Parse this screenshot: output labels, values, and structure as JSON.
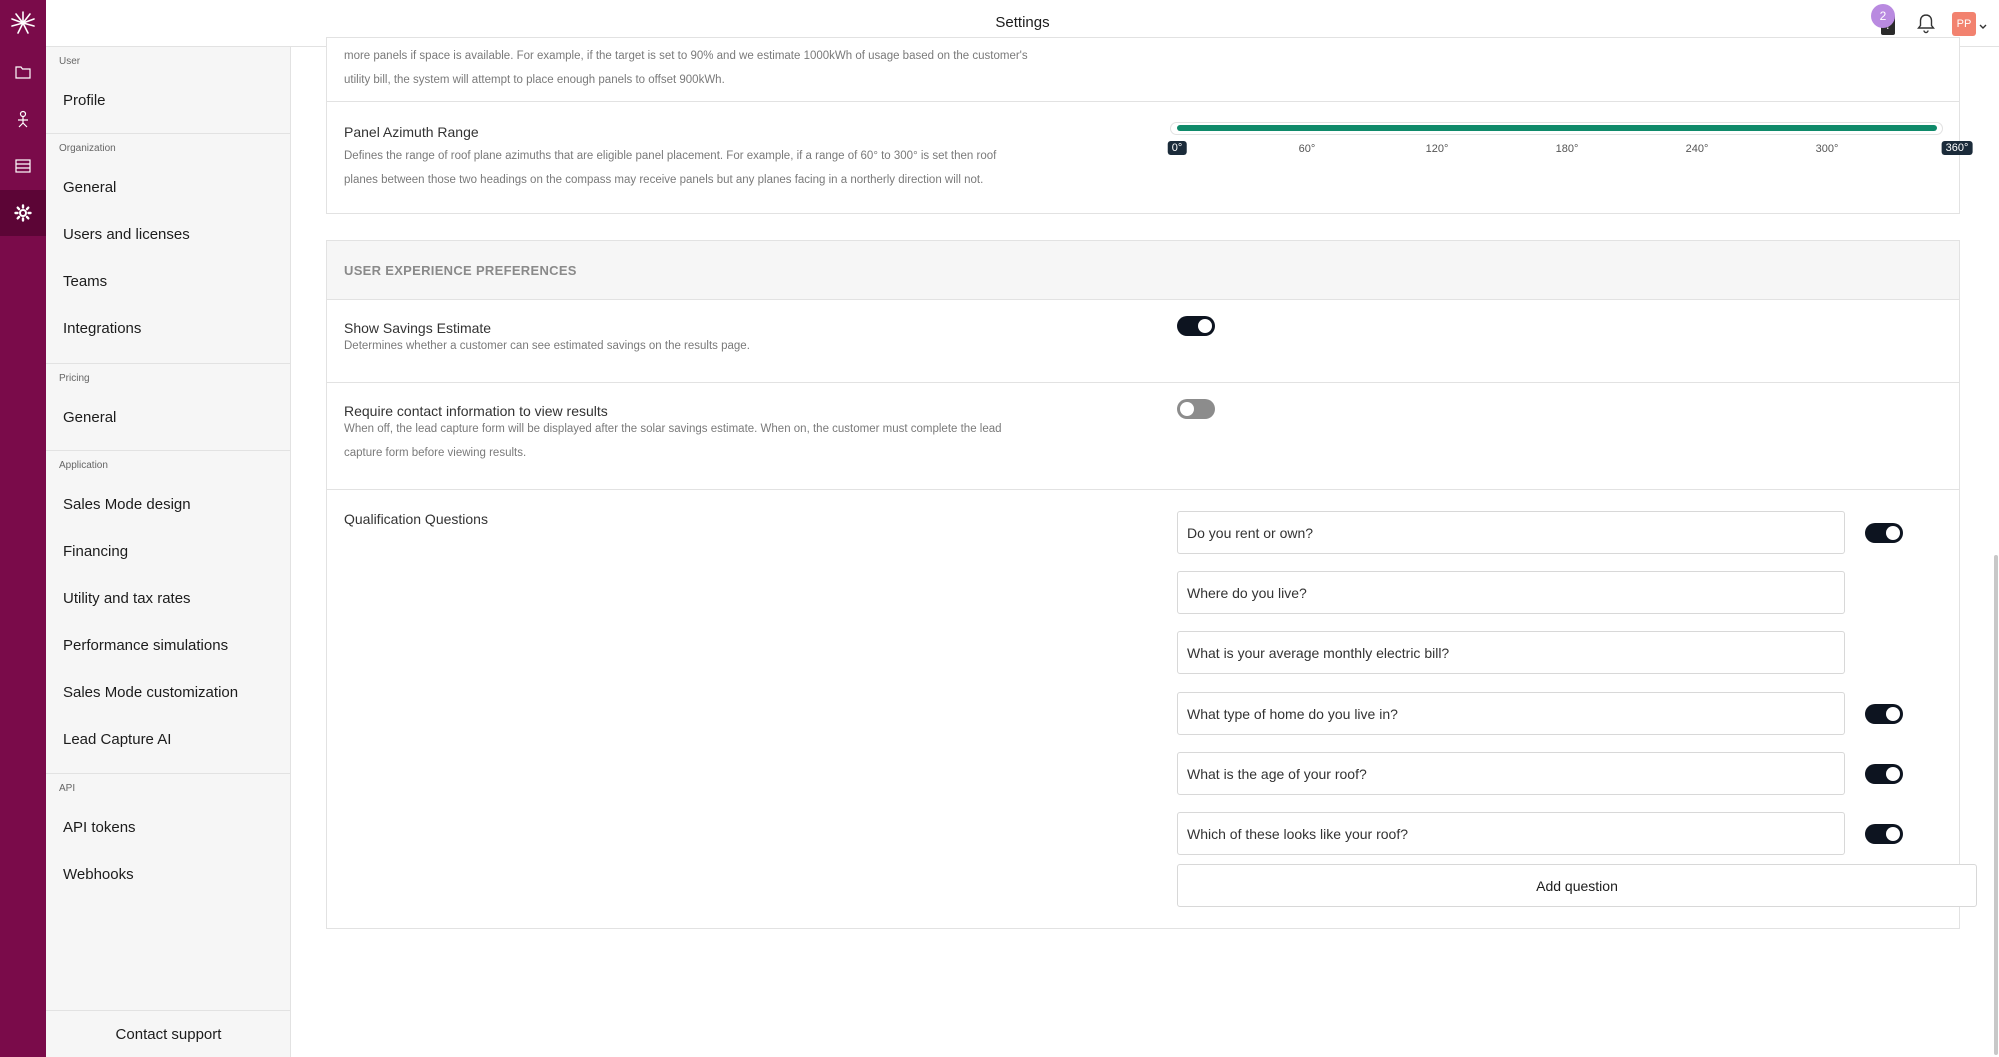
{
  "topbar": {
    "title": "Settings",
    "notification_count": "2",
    "avatar_initials": "PP"
  },
  "sidebar": {
    "user_label": "User",
    "profile": "Profile",
    "organization_label": "Organization",
    "org_general": "General",
    "users_licenses": "Users and licenses",
    "teams": "Teams",
    "integrations": "Integrations",
    "pricing_label": "Pricing",
    "pricing_general": "General",
    "application_label": "Application",
    "sales_mode_design": "Sales Mode design",
    "financing": "Financing",
    "utility_tax": "Utility and tax rates",
    "performance_sim": "Performance simulations",
    "sales_mode_custom": "Sales Mode customization",
    "lead_capture": "Lead Capture AI",
    "api_label": "API",
    "api_tokens": "API tokens",
    "webhooks": "Webhooks",
    "contact_support": "Contact support"
  },
  "design": {
    "offset_desc_line1": "more panels if space is available. For example, if the target is set to 90% and we estimate 1000kWh of usage based on the customer's",
    "offset_desc_line2": "utility bill, the system will attempt to place enough panels to offset 900kWh.",
    "azimuth_title": "Panel Azimuth Range",
    "azimuth_desc_line1": "Defines the range of roof plane azimuths that are eligible panel placement. For example, if a range of 60° to 300° is set then roof",
    "azimuth_desc_line2": "planes between those two headings on the compass may receive panels but any planes facing in a northerly direction will not.",
    "azimuth_ticks": [
      "0°",
      "60°",
      "120°",
      "180°",
      "240°",
      "300°",
      "360°"
    ],
    "azimuth_range": [
      0,
      360
    ],
    "accent_color": "#0f8a6a"
  },
  "ux": {
    "section_title": "USER EXPERIENCE PREFERENCES",
    "savings_title": "Show Savings Estimate",
    "savings_desc": "Determines whether a customer can see estimated savings on the results page.",
    "savings_on": true,
    "contact_title": "Require contact information to view results",
    "contact_desc_line1": "When off, the lead capture form will be displayed after the solar savings estimate. When on, the customer must complete the lead",
    "contact_desc_line2": "capture form before viewing results.",
    "contact_on": false,
    "questions_title": "Qualification Questions",
    "questions": [
      {
        "text": "Do you rent or own?",
        "toggle": true
      },
      {
        "text": "Where do you live?",
        "toggle": null
      },
      {
        "text": "What is your average monthly electric bill?",
        "toggle": null
      },
      {
        "text": "What type of home do you live in?",
        "toggle": true
      },
      {
        "text": "What is the age of your roof?",
        "toggle": true
      },
      {
        "text": "Which of these looks like your roof?",
        "toggle": true
      }
    ],
    "add_question": "Add question"
  },
  "brand_color": "#7a0b4a"
}
